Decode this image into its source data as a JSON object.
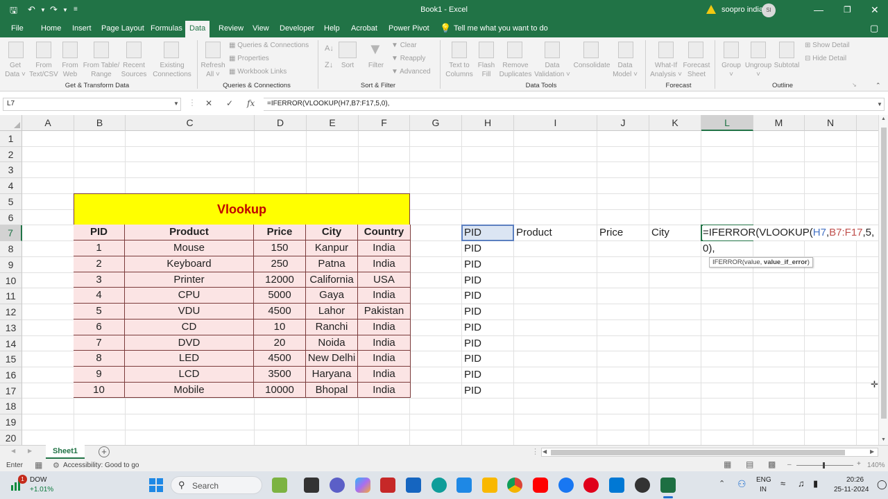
{
  "titlebar": {
    "title": "Book1  -  Excel",
    "user": "soopro india",
    "avatar_initials": "SI",
    "save_icon": "⬛",
    "undo_icon": "↶",
    "redo_icon": "↷",
    "customize_icon": "≡",
    "minimize_icon": "—",
    "restore_icon": "❐",
    "close_icon": "✕"
  },
  "menu": {
    "tabs": [
      "File",
      "Home",
      "Insert",
      "Page Layout",
      "Formulas",
      "Data",
      "Review",
      "View",
      "Developer",
      "Help",
      "Acrobat",
      "Power Pivot"
    ],
    "active": "Data",
    "tell_me": "Tell me what you want to do",
    "comments_icon": "▢"
  },
  "ribbon": {
    "groups": {
      "get_transform": "Get & Transform Data",
      "queries": "Queries & Connections",
      "sort_filter": "Sort & Filter",
      "data_tools": "Data Tools",
      "forecast": "Forecast",
      "outline": "Outline"
    },
    "buttons": {
      "get_data": "Get\nData ˅",
      "from_text": "From\nText/CSV",
      "from_web": "From\nWeb",
      "from_table": "From Table/\nRange",
      "recent_sources": "Recent\nSources",
      "existing_connections": "Existing\nConnections",
      "refresh_all": "Refresh\nAll ˅",
      "queries_connections": "Queries & Connections",
      "properties": "Properties",
      "workbook_links": "Workbook Links",
      "sort": "Sort",
      "filter": "Filter",
      "clear": "Clear",
      "reapply": "Reapply",
      "advanced": "Advanced",
      "text_to_columns": "Text to\nColumns",
      "flash_fill": "Flash\nFill",
      "remove_duplicates": "Remove\nDuplicates",
      "data_validation": "Data\nValidation ˅",
      "consolidate": "Consolidate",
      "data_model": "Data\nModel ˅",
      "what_if": "What-If\nAnalysis ˅",
      "forecast_sheet": "Forecast\nSheet",
      "group": "Group\n˅",
      "ungroup": "Ungroup\n˅",
      "subtotal": "Subtotal",
      "show_detail": "Show Detail",
      "hide_detail": "Hide Detail"
    }
  },
  "formula_bar": {
    "name_box": "L7",
    "formula": "=IFERROR(VLOOKUP(H7,B7:F17,5,0),",
    "cancel": "✕",
    "enter": "✓",
    "fx": "fx"
  },
  "grid": {
    "columns": [
      "A",
      "B",
      "C",
      "D",
      "E",
      "F",
      "G",
      "H",
      "I",
      "J",
      "K",
      "L",
      "M",
      "N"
    ],
    "rows": [
      "1",
      "2",
      "3",
      "4",
      "5",
      "6",
      "7",
      "8",
      "9",
      "10",
      "11",
      "12",
      "13",
      "14",
      "15",
      "16",
      "17",
      "18",
      "19",
      "20"
    ],
    "selected_col": "L",
    "selected_row": "7"
  },
  "table": {
    "title": "Vlookup",
    "headers": [
      "PID",
      "Product",
      "Price",
      "City",
      "Country"
    ],
    "rows": [
      [
        "1",
        "Mouse",
        "150",
        "Kanpur",
        "India"
      ],
      [
        "2",
        "Keyboard",
        "250",
        "Patna",
        "India"
      ],
      [
        "3",
        "Printer",
        "12000",
        "California",
        "USA"
      ],
      [
        "4",
        "CPU",
        "5000",
        "Gaya",
        "India"
      ],
      [
        "5",
        "VDU",
        "4500",
        "Lahor",
        "Pakistan"
      ],
      [
        "6",
        "CD",
        "10",
        "Ranchi",
        "India"
      ],
      [
        "7",
        "DVD",
        "20",
        "Noida",
        "India"
      ],
      [
        "8",
        "LED",
        "4500",
        "New Delhi",
        "India"
      ],
      [
        "9",
        "LCD",
        "3500",
        "Haryana",
        "India"
      ],
      [
        "10",
        "Mobile",
        "10000",
        "Bhopal",
        "India"
      ]
    ],
    "colors": {
      "title_bg": "#ffff00",
      "title_fg": "#c00000",
      "cell_bg": "#fbe4e4",
      "border": "#7a3a3a"
    }
  },
  "lookup": {
    "headers": {
      "h": "PID",
      "i": "Product",
      "j": "Price",
      "k": "City"
    },
    "pid_values": [
      "PID",
      "PID",
      "PID",
      "PID",
      "PID",
      "PID",
      "PID",
      "PID",
      "PID",
      "PID"
    ],
    "edit_parts": {
      "p1": "=IFERROR(VLOOKUP(",
      "p2": "H7",
      "p3": ",",
      "p4": "B7:F17",
      "p5": ",5,",
      "line2": "0),"
    },
    "tooltip": {
      "text": "IFERROR(value, ",
      "bold": "value_if_error",
      "end": ")"
    }
  },
  "sheets": {
    "tabs": [
      "Sheet1"
    ],
    "add": "+"
  },
  "status": {
    "mode": "Enter",
    "accessibility": "Accessibility: Good to go",
    "zoom": "140%"
  },
  "taskbar": {
    "stock_name": "DOW",
    "stock_change": "+1.01%",
    "search_placeholder": "Search",
    "lang1": "ENG",
    "lang2": "IN",
    "time": "20:26",
    "date": "25-11-2024",
    "notification_count": "1"
  }
}
